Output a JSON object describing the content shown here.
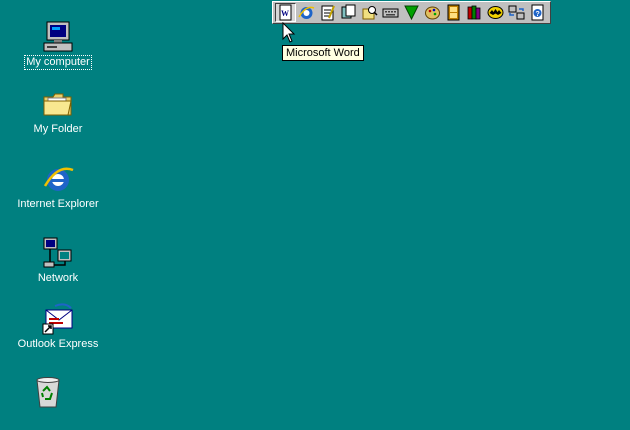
{
  "desktop": {
    "background": "#008080",
    "icons": [
      {
        "id": "my-computer",
        "label": "My computer",
        "selected": true,
        "icon": "computer-icon"
      },
      {
        "id": "my-folder",
        "label": "My Folder",
        "selected": false,
        "icon": "folder-icon"
      },
      {
        "id": "internet-explorer",
        "label": "Internet Explorer",
        "selected": false,
        "icon": "internet-explorer-icon"
      },
      {
        "id": "network",
        "label": "Network",
        "selected": false,
        "icon": "network-icon"
      },
      {
        "id": "outlook-express",
        "label": "Outlook Express",
        "selected": false,
        "icon": "outlook-express-icon"
      },
      {
        "id": "recycle-bin",
        "label": "",
        "selected": false,
        "icon": "recycle-bin-icon"
      }
    ]
  },
  "quick_toolbar": {
    "buttons": [
      {
        "name": "word",
        "icon": "word-document-icon",
        "pressed": true
      },
      {
        "name": "ie",
        "icon": "internet-explorer-small-icon",
        "pressed": false
      },
      {
        "name": "notepad",
        "icon": "notepad-icon",
        "pressed": false
      },
      {
        "name": "copy",
        "icon": "copy-icon",
        "pressed": false
      },
      {
        "name": "find",
        "icon": "find-icon",
        "pressed": false
      },
      {
        "name": "keyboard",
        "icon": "keyboard-icon",
        "pressed": false
      },
      {
        "name": "green-arrow",
        "icon": "green-arrow-icon",
        "pressed": false
      },
      {
        "name": "paint",
        "icon": "paint-icon",
        "pressed": false
      },
      {
        "name": "film",
        "icon": "film-icon",
        "pressed": false
      },
      {
        "name": "books",
        "icon": "books-icon",
        "pressed": false
      },
      {
        "name": "bat",
        "icon": "bat-icon",
        "pressed": false
      },
      {
        "name": "network-transfer",
        "icon": "network-transfer-icon",
        "pressed": false
      },
      {
        "name": "help",
        "icon": "help-icon",
        "pressed": false
      }
    ]
  },
  "tooltip": {
    "text": "Microsoft Word"
  }
}
